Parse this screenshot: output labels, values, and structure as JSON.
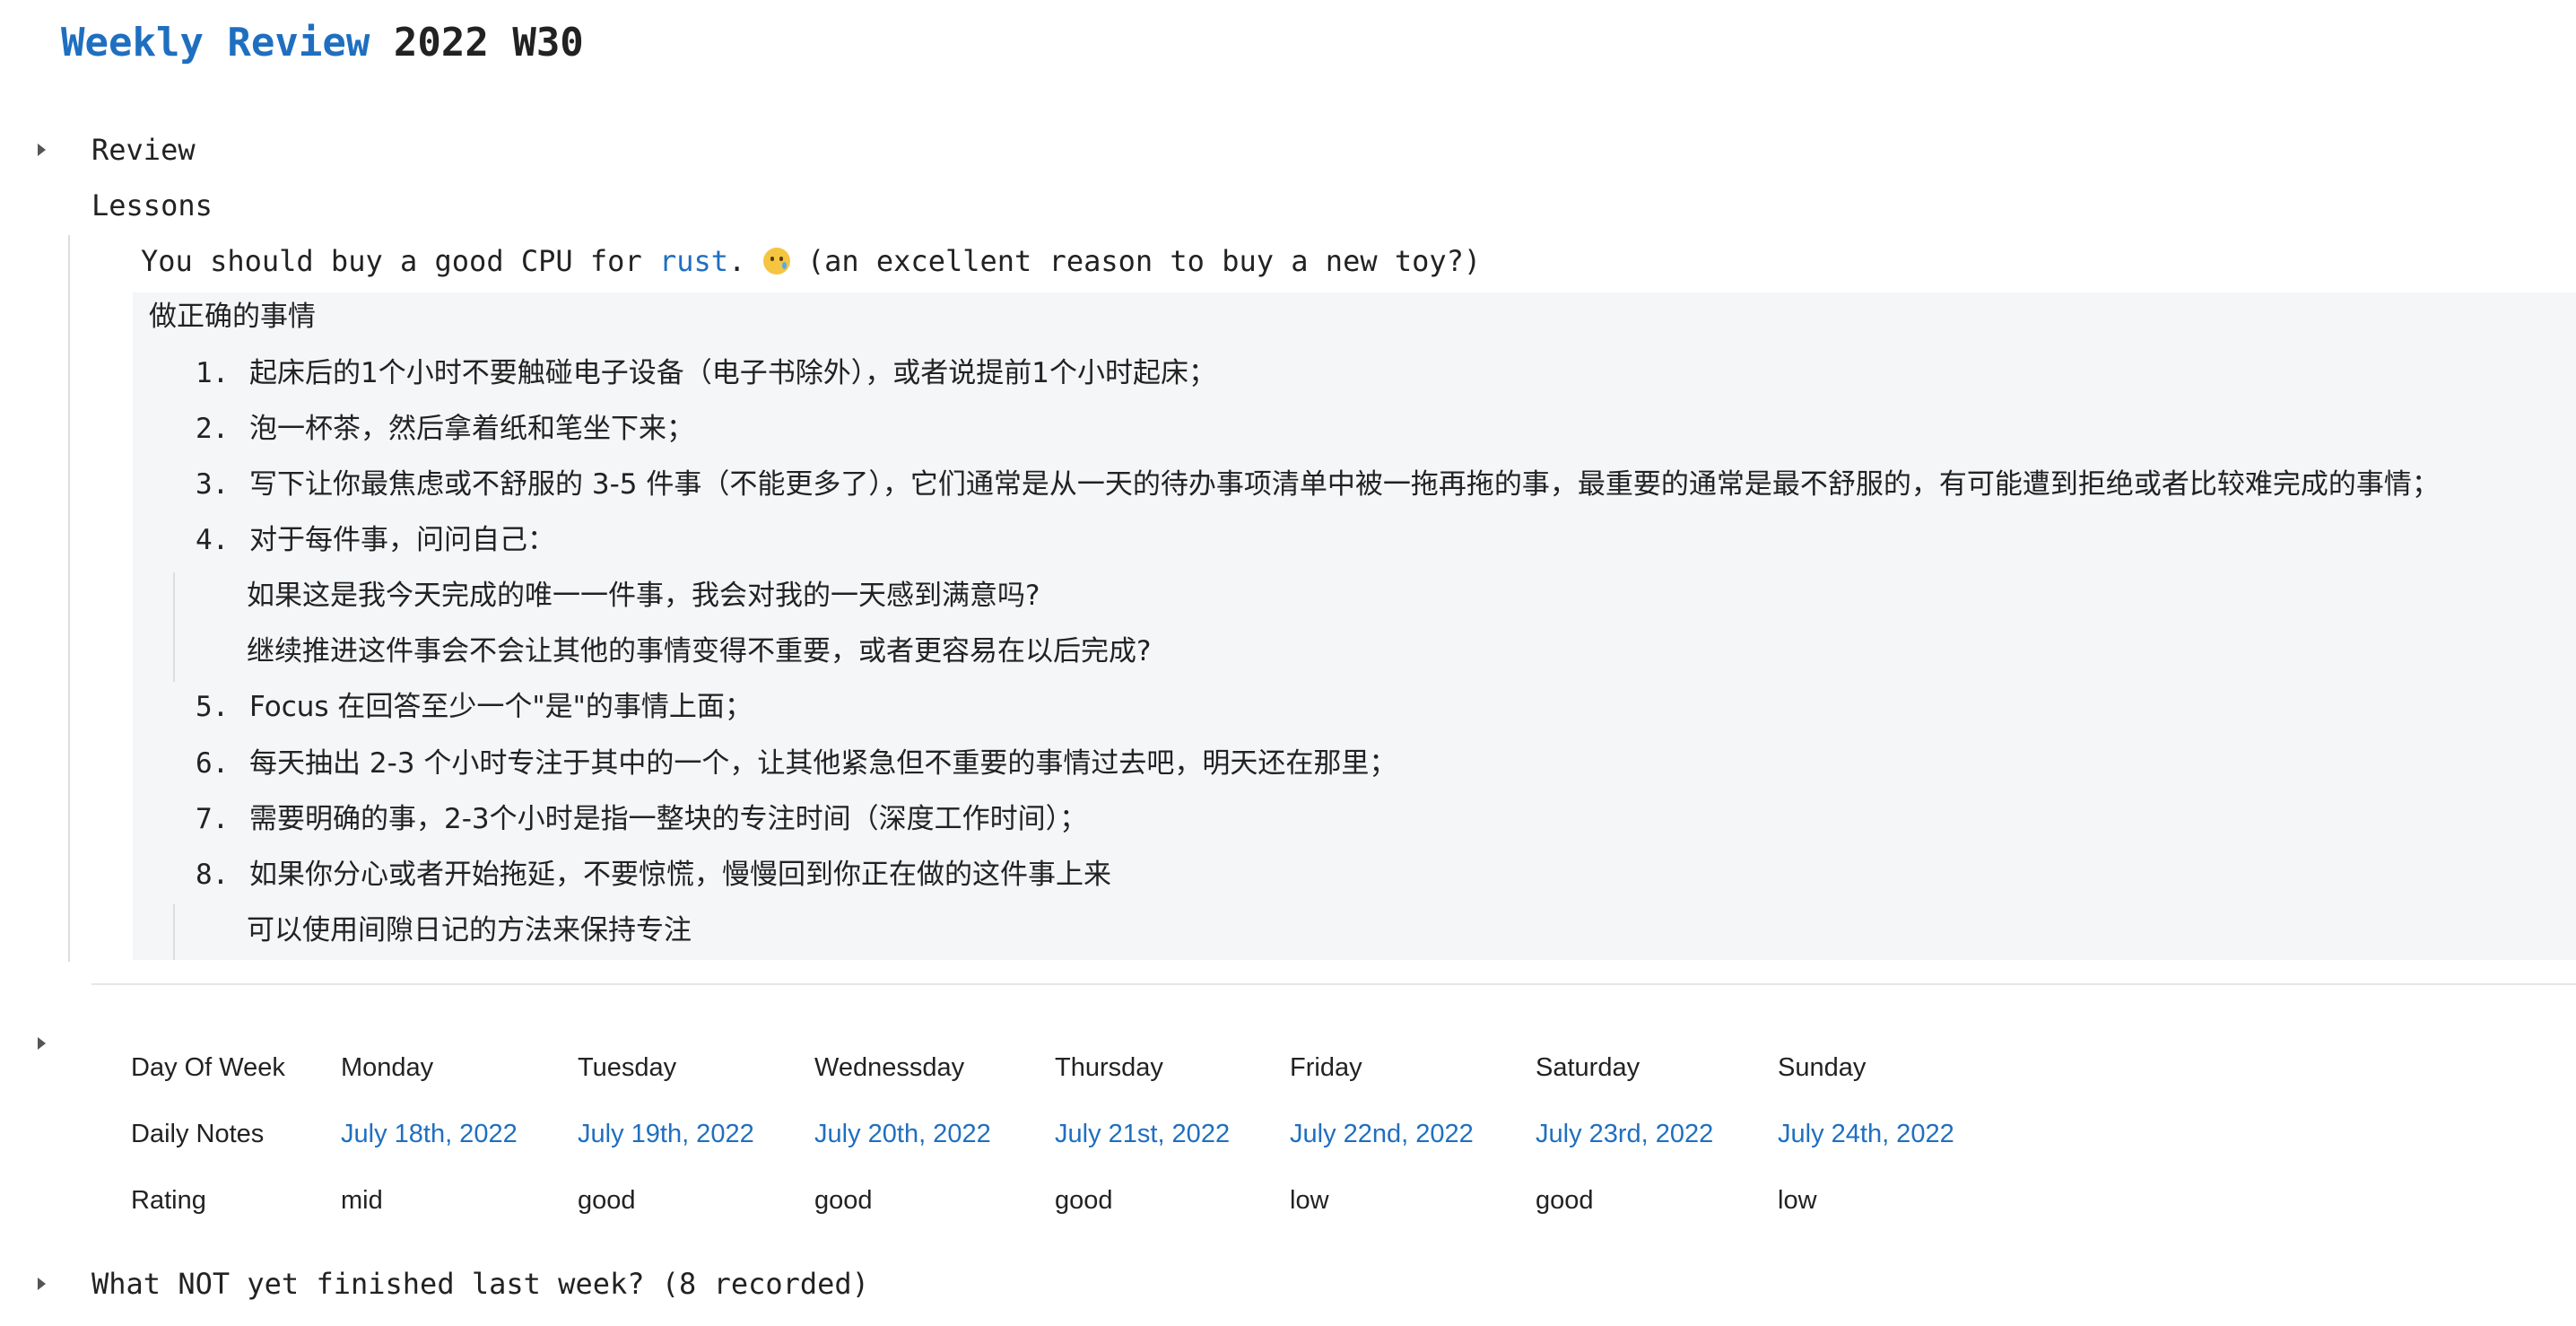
{
  "page": {
    "title_link": "Weekly Review",
    "title_rest": "2022 W30"
  },
  "blocks": {
    "review": "Review",
    "lessons": "Lessons",
    "lesson_line_pre": "You should buy a good CPU for ",
    "lesson_line_link": "rust",
    "lesson_line_dot": ".",
    "lesson_line_post": "(an excellent reason to buy a new toy?)",
    "emoji_icon": "crying-face-icon",
    "quote_heading": "做正确的事情",
    "list": [
      {
        "num": "1.",
        "text": "起床后的1个小时不要触碰电子设备（电子书除外），或者说提前1个小时起床；"
      },
      {
        "num": "2.",
        "text": "泡一杯茶，然后拿着纸和笔坐下来；"
      },
      {
        "num": "3.",
        "text": "写下让你最焦虑或不舒服的 3-5 件事（不能更多了），它们通常是从一天的待办事项清单中被一拖再拖的事，最重要的通常是最不舒服的，有可能遭到拒绝或者比较难完成的事情；"
      },
      {
        "num": "4.",
        "text": "对于每件事，问问自己："
      },
      {
        "num": "5.",
        "text": "Focus 在回答至少一个\"是\"的事情上面；"
      },
      {
        "num": "6.",
        "text": "每天抽出 2-3 个小时专注于其中的一个，让其他紧急但不重要的事情过去吧，明天还在那里；"
      },
      {
        "num": "7.",
        "text": "需要明确的事，2-3个小时是指一整块的专注时间（深度工作时间）；"
      },
      {
        "num": "8.",
        "text": "如果你分心或者开始拖延，不要惊慌，慢慢回到你正在做的这件事上来"
      }
    ],
    "sub4": [
      "如果这是我今天完成的唯一一件事，我会对我的一天感到满意吗?",
      "继续推进这件事会不会让其他的事情变得不重要，或者更容易在以后完成?"
    ],
    "sub8": "可以使用间隙日记的方法来保持专注"
  },
  "table": {
    "row_labels": [
      "Day Of Week",
      "Daily Notes",
      "Rating"
    ],
    "days": [
      "Monday",
      "Tuesday",
      "Wednessday",
      "Thursday",
      "Friday",
      "Saturday",
      "Sunday"
    ],
    "notes": [
      "July 18th, 2022",
      "July 19th, 2022",
      "July 20th, 2022",
      "July 21st, 2022",
      "July 22nd, 2022",
      "July 23rd, 2022",
      "July 24th, 2022"
    ],
    "ratings": [
      "mid",
      "good",
      "good",
      "good",
      "low",
      "good",
      "low"
    ]
  },
  "footer": {
    "unfinished": "What NOT yet finished last week? (8 recorded)"
  },
  "colors": {
    "link": "#1f6fc0",
    "quote_bg": "#f4f6f8"
  }
}
